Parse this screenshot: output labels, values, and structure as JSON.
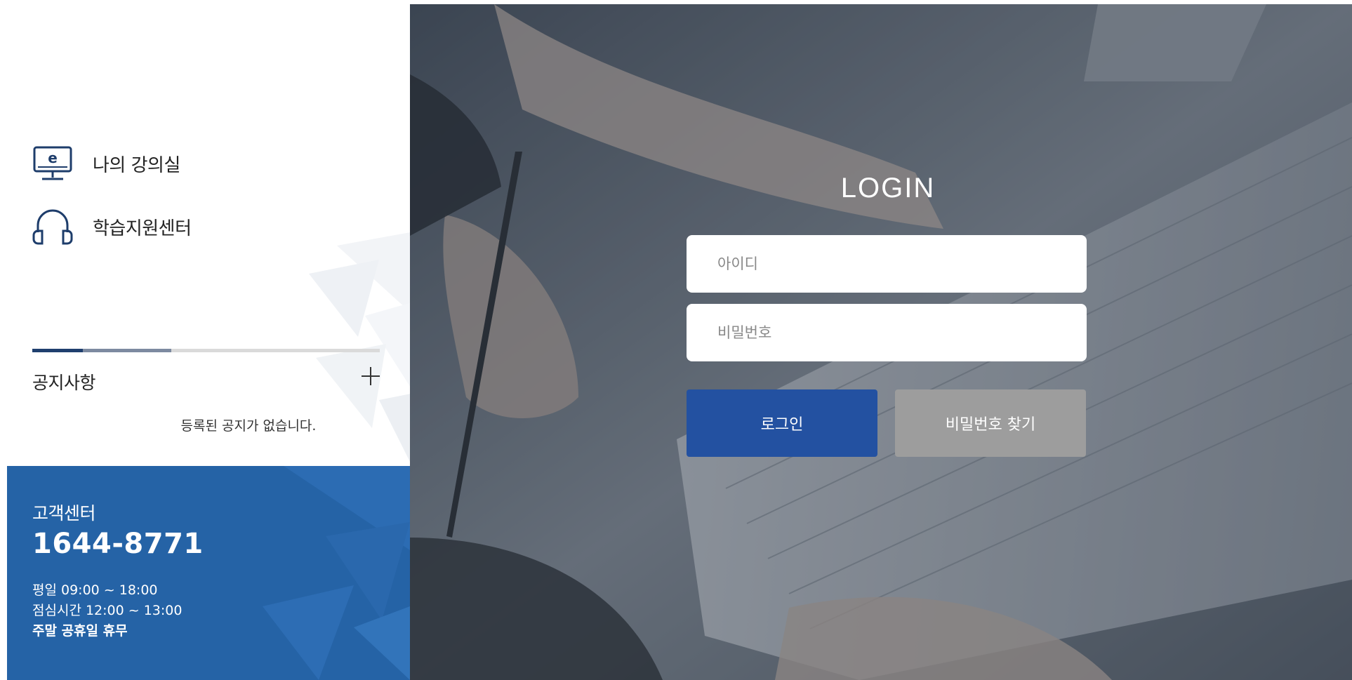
{
  "quick_links": [
    {
      "label": "나의 강의실",
      "icon": "e-learning-monitor-icon"
    },
    {
      "label": "학습지원센터",
      "icon": "headset-icon"
    }
  ],
  "notice": {
    "title": "공지사항",
    "more_icon": "plus-icon",
    "empty_message": "등록된 공지가 없습니다."
  },
  "customer_center": {
    "title": "고객센터",
    "phone": "1644-8771",
    "weekday_hours": "평일 09:00 ~ 18:00",
    "lunch_hours": "점심시간 12:00 ~ 13:00",
    "closed": "주말 공휴일 휴무"
  },
  "login": {
    "title": "LOGIN",
    "id_placeholder": "아이디",
    "password_placeholder": "비밀번호",
    "login_button": "로그인",
    "find_password_button": "비밀번호 찾기"
  },
  "colors": {
    "primary_blue": "#2351a1",
    "customer_center_bg": "#2563a6",
    "secondary_gray": "#9d9d9d"
  }
}
